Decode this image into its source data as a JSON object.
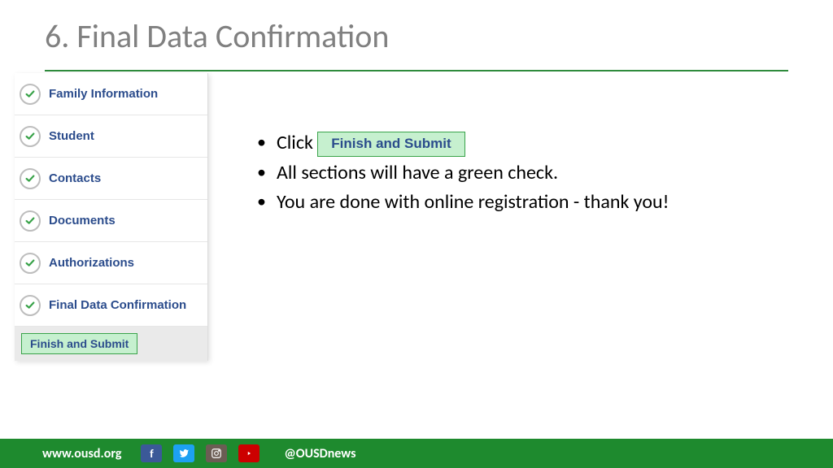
{
  "title": "6. Final Data Confirmation",
  "sidebar": {
    "items": [
      {
        "label": "Family Information"
      },
      {
        "label": "Student"
      },
      {
        "label": "Contacts"
      },
      {
        "label": "Documents"
      },
      {
        "label": "Authorizations"
      },
      {
        "label": "Final Data Confirmation"
      }
    ],
    "finish_label": "Finish and Submit"
  },
  "content": {
    "bullet1_prefix": "Click ",
    "bullet1_button": "Finish and Submit",
    "bullet2": "All sections will have a green check.",
    "bullet3": "You are done with online registration - thank you!"
  },
  "footer": {
    "url": "www.ousd.org",
    "handle": "@OUSDnews"
  }
}
